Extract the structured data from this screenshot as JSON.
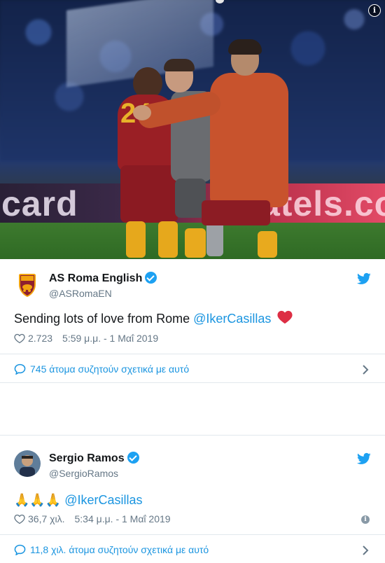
{
  "photo": {
    "board_left": "card",
    "board_right": "atels.co",
    "shirt_number": "24",
    "info_glyph": "i"
  },
  "tweets": [
    {
      "display_name": "AS Roma English",
      "handle": "@ASRomaEN",
      "text": "Sending lots of love from Rome ",
      "mention": "@IkerCasillas",
      "emoji": "❤️",
      "likes": "2.723",
      "timestamp": "5:59 μ.μ. - 1 Μαΐ 2019",
      "conversation": "745 άτομα συζητούν σχετικά με αυτό",
      "avatar_icon": "as-roma-crest-icon"
    },
    {
      "display_name": "Sergio Ramos",
      "handle": "@SergioRamos",
      "emoji": "🙏🙏🙏",
      "mention": "@IkerCasillas",
      "likes": "36,7 χιλ.",
      "timestamp": "5:34 μ.μ. - 1 Μαΐ 2019",
      "conversation": "11,8 χιλ. άτομα συζητούν σχετικά με αυτό",
      "avatar_icon": "sergio-ramos-avatar"
    }
  ],
  "colors": {
    "twitter_blue": "#1da1f2",
    "link_blue": "#1b95e0",
    "heart_red": "#e0245e",
    "muted_text": "#657786"
  }
}
